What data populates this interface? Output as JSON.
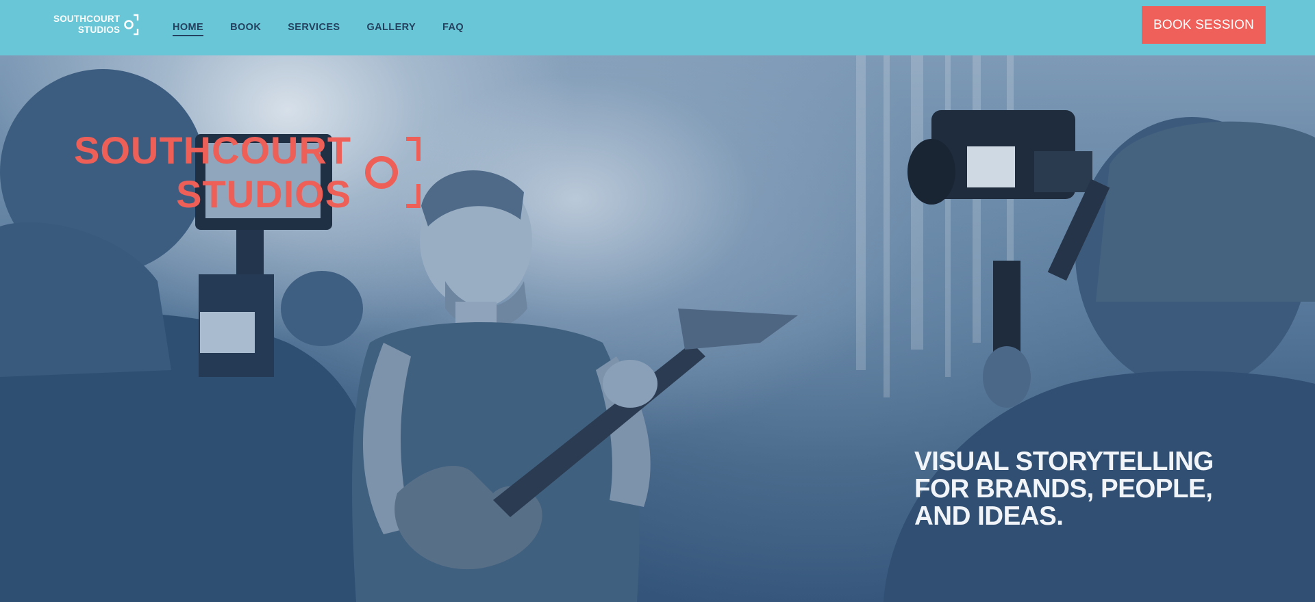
{
  "brand": {
    "line1": "SOUTHCOURT",
    "line2": "STUDIOS"
  },
  "nav": {
    "items": [
      {
        "label": "HOME",
        "active": true
      },
      {
        "label": "BOOK",
        "active": false
      },
      {
        "label": "SERVICES",
        "active": false
      },
      {
        "label": "GALLERY",
        "active": false
      },
      {
        "label": "FAQ",
        "active": false
      }
    ]
  },
  "cta": {
    "label": "BOOK SESSION"
  },
  "hero": {
    "logo_line1": "SOUTHCOURT",
    "logo_line2": "STUDIOS",
    "tagline": [
      "VISUAL STORYTELLING",
      "FOR BRANDS, PEOPLE,",
      "AND IDEAS."
    ],
    "image_icon": "hero-photo"
  },
  "colors": {
    "header_bg": "#68c6d6",
    "accent": "#f0605a",
    "nav_text": "#24415f",
    "hero_overlay": "#3a5a7a"
  }
}
